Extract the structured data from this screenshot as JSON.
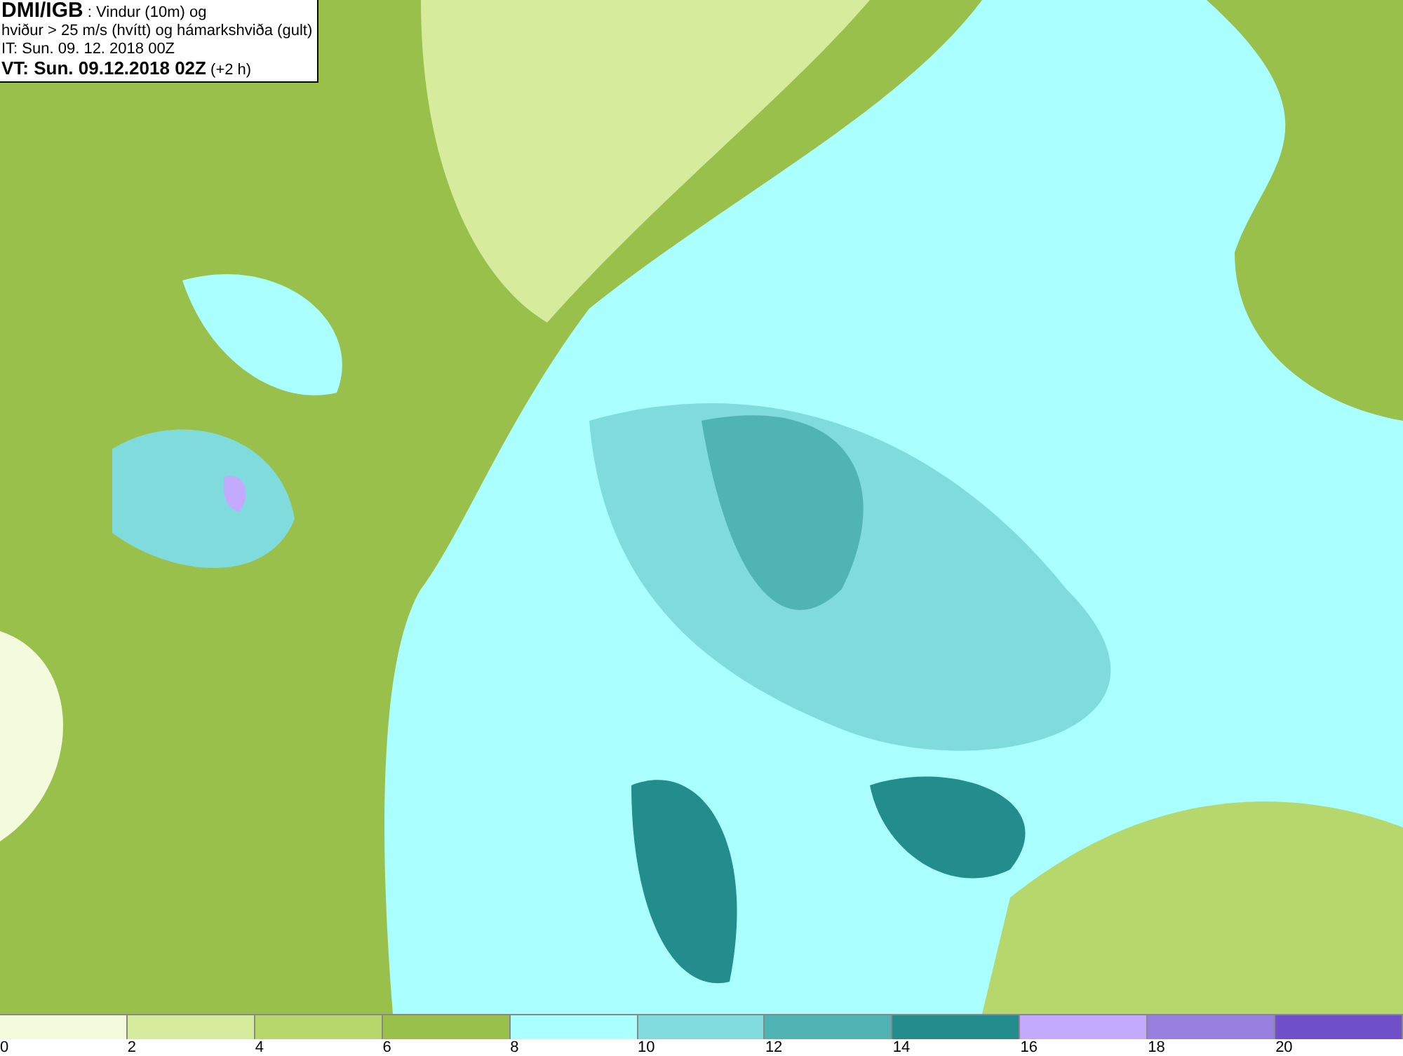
{
  "title_box": {
    "lines": [
      "**DMI/IGB** : Vindur (10m) og",
      "hviður > 25 m/s (hvítt) og hámarkshviða (gult)",
      "IT: Sun. 09. 12. 2018 00Z",
      "**VT: Sun. 09.12.2018 02Z** (+2 h)"
    ]
  },
  "legend": [
    {
      "label": "0",
      "color": "#f4fbdc"
    },
    {
      "label": "2",
      "color": "#d6ec9c"
    },
    {
      "label": "4",
      "color": "#b6d76c"
    },
    {
      "label": "6",
      "color": "#98c04a"
    },
    {
      "label": "8",
      "color": "#aaffff"
    },
    {
      "label": "10",
      "color": "#80dcdc"
    },
    {
      "label": "12",
      "color": "#50b4b4"
    },
    {
      "label": "14",
      "color": "#238c8c"
    },
    {
      "label": "16",
      "color": "#c4aaff"
    },
    {
      "label": "18",
      "color": "#9880e0"
    },
    {
      "label": "20",
      "color": "#7050c8"
    }
  ]
}
